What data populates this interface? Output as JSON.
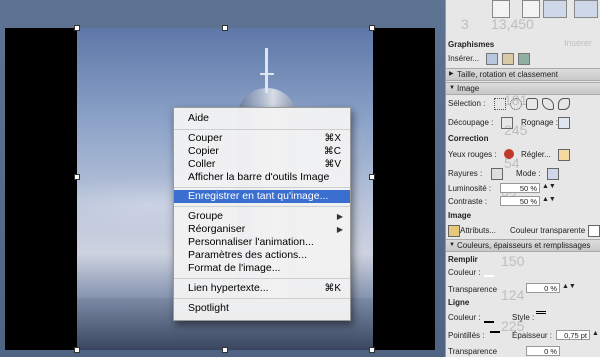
{
  "context_menu": {
    "items": [
      {
        "label": "Aide",
        "shortcut": "",
        "submenu": false,
        "selected": false
      },
      {
        "label": "Couper",
        "shortcut": "⌘X",
        "submenu": false,
        "selected": false
      },
      {
        "label": "Copier",
        "shortcut": "⌘C",
        "submenu": false,
        "selected": false
      },
      {
        "label": "Coller",
        "shortcut": "⌘V",
        "submenu": false,
        "selected": false
      },
      {
        "label": "Afficher la barre d'outils Image",
        "shortcut": "",
        "submenu": false,
        "selected": false
      },
      {
        "label": "Enregistrer en tant qu'image...",
        "shortcut": "",
        "submenu": false,
        "selected": true
      },
      {
        "label": "Groupe",
        "shortcut": "",
        "submenu": true,
        "selected": false
      },
      {
        "label": "Réorganiser",
        "shortcut": "",
        "submenu": true,
        "selected": false
      },
      {
        "label": "Personnaliser l'animation...",
        "shortcut": "",
        "submenu": false,
        "selected": false
      },
      {
        "label": "Paramètres des actions...",
        "shortcut": "",
        "submenu": false,
        "selected": false
      },
      {
        "label": "Format de l'image...",
        "shortcut": "",
        "submenu": false,
        "selected": false
      },
      {
        "label": "Lien hypertexte...",
        "shortcut": "⌘K",
        "submenu": false,
        "selected": false
      },
      {
        "label": "Spotlight",
        "shortcut": "",
        "submenu": false,
        "selected": false
      }
    ]
  },
  "palette": {
    "ghost": {
      "top_number": "13,450",
      "left_number": "3",
      "insert": "Insérer",
      "n181": "181",
      "n245": "245",
      "n54": "54",
      "n83": "83",
      "n150": "150",
      "n124": "124",
      "n225": "225"
    },
    "graphics_header": "Graphismes",
    "insert_label": "Insérer...",
    "size_section": "Taille, rotation et classement",
    "image_section": "Image",
    "selection_label": "Sélection :",
    "crop_label": "Découpage :",
    "crop_sublabel": "Rognage :",
    "correction_header": "Correction",
    "red_eye_label": "Yeux rouges :",
    "adjust_label": "Régler...",
    "scratches_label": "Rayures :",
    "mode_label": "Mode :",
    "brightness_label": "Luminosité :",
    "brightness_value": "50 %",
    "contrast_label": "Contraste :",
    "contrast_value": "50 %",
    "image_header": "Image",
    "attributes_label": "Attributs...",
    "transparent_label": "Couleur transparente :",
    "colors_section": "Couleurs, épaisseurs et remplissages",
    "fill_header": "Remplir",
    "fill_color_label": "Couleur :",
    "fill_transparency_label": "Transparence",
    "fill_transparency_value": "0 %",
    "line_header": "Ligne",
    "line_color_label": "Couleur :",
    "style_label": "Style :",
    "dashed_label": "Pointillés :",
    "weight_label": "Épaisseur :",
    "weight_value": "0,75 pt",
    "line_transparency_label": "Transparence",
    "line_transparency_value": "0 %"
  },
  "colors": {
    "selection": "#3a6fcf",
    "menu_bg": "#f2f2f2",
    "palette_bg": "#e7e7e7",
    "desk": "#5b6f8c"
  }
}
